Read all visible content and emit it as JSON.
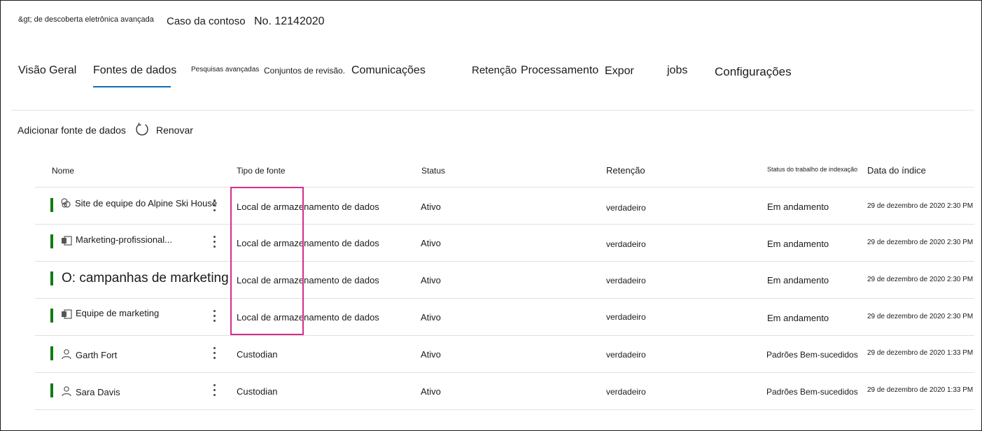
{
  "header": {
    "breadcrumb": "&gt; de descoberta eletrônica avançada",
    "case_name": "Caso da contoso",
    "case_number": "No. 12142020"
  },
  "tabs": [
    {
      "label": "Visão Geral",
      "selected": false
    },
    {
      "label": "Fontes de dados",
      "selected": true
    },
    {
      "label": "Pesquisas avançadas",
      "selected": false
    },
    {
      "label": "Conjuntos de revisão.",
      "selected": false
    },
    {
      "label": "Comunicações",
      "selected": false
    },
    {
      "label": "Retenção",
      "selected": false
    },
    {
      "label": "Processamento",
      "selected": false
    },
    {
      "label": "Expor",
      "selected": false
    },
    {
      "label": "jobs",
      "selected": false
    },
    {
      "label": "Configurações",
      "selected": false
    }
  ],
  "commands": {
    "add_label": "Adicionar fonte de dados",
    "refresh_label": "Renovar",
    "refresh_icon": "refresh-icon"
  },
  "table": {
    "columns": [
      "Nome",
      "Tipo de fonte",
      "Status",
      "Retenção",
      "Status do trabalho de indexação",
      "Data do índice"
    ],
    "rows": [
      {
        "name": "Site de equipe do Alpine Ski House",
        "icon": "sharepoint-site-icon",
        "source_type": "Local de armazenamento de dados",
        "status": "Ativo",
        "retention": "verdadeiro",
        "index_status": "Em andamento",
        "index_date": "29 de dezembro de 2020 2:30 PM"
      },
      {
        "name": "Marketing-profissional...",
        "icon": "office-group-icon",
        "source_type": "Local de armazenamento de dados",
        "status": "Ativo",
        "retention": "verdadeiro",
        "index_status": "Em andamento",
        "index_date": "29 de dezembro de 2020 2:30 PM"
      },
      {
        "name": "O: campanhas de marketing",
        "icon": "",
        "source_type": "Local de armazenamento de dados",
        "status": "Ativo",
        "retention": "verdadeiro",
        "index_status": "Em andamento",
        "index_date": "29 de dezembro de 2020 2:30 PM"
      },
      {
        "name": "Equipe de marketing",
        "icon": "office-group-icon",
        "source_type": "Local de armazenamento de dados",
        "status": "Ativo",
        "retention": "verdadeiro",
        "index_status": "Em andamento",
        "index_date": "29 de dezembro de 2020 2:30 PM"
      },
      {
        "name": "Garth Fort",
        "icon": "person-icon",
        "source_type": "Custodian",
        "status": "Ativo",
        "retention": "verdadeiro",
        "index_status": "Padrões Bem-sucedidos",
        "index_date": "29 de dezembro de 2020 1:33 PM"
      },
      {
        "name": "Sara Davis",
        "icon": "person-icon",
        "source_type": "Custodian",
        "status": "Ativo",
        "retention": "verdadeiro",
        "index_status": "Padrões Bem-sucedidos",
        "index_date": "29 de dezembro de 2020 1:33 PM"
      }
    ]
  },
  "colors": {
    "accent": "#0f6cbd",
    "status_bar": "#107c10",
    "highlight": "#d42e8c"
  }
}
